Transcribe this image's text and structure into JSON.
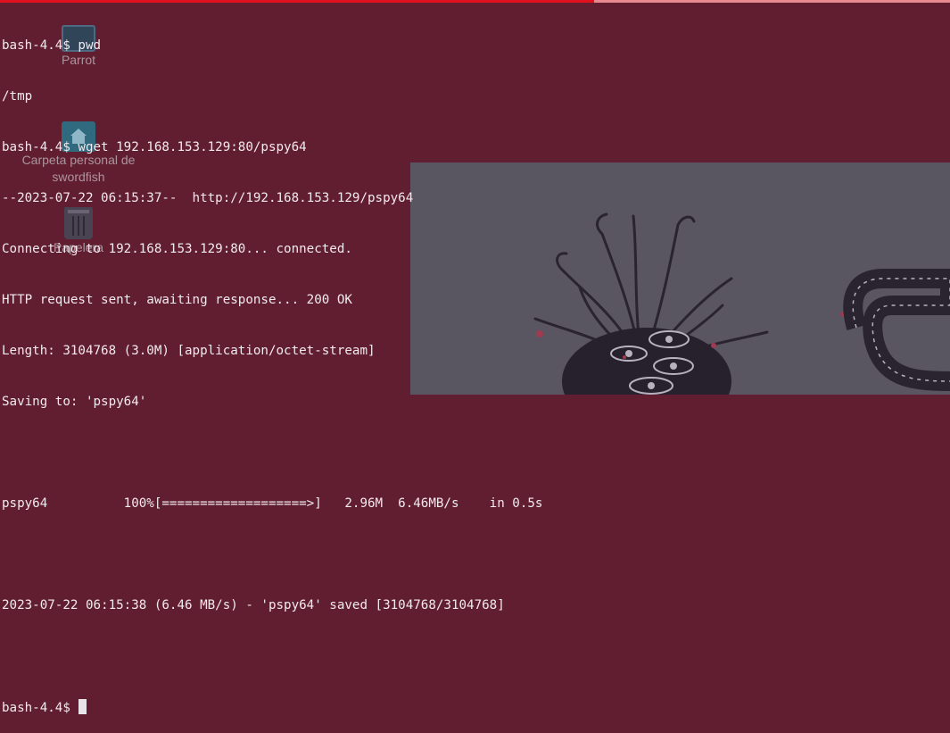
{
  "terminal": {
    "lines": [
      "bash-4.4$ pwd",
      "/tmp",
      "bash-4.4$ wget 192.168.153.129:80/pspy64",
      "--2023-07-22 06:15:37--  http://192.168.153.129/pspy64",
      "Connecting to 192.168.153.129:80... connected.",
      "HTTP request sent, awaiting response... 200 OK",
      "Length: 3104768 (3.0M) [application/octet-stream]",
      "Saving to: 'pspy64'",
      "",
      "pspy64          100%[===================>]   2.96M  6.46MB/s    in 0.5s",
      "",
      "2023-07-22 06:15:38 (6.46 MB/s) - 'pspy64' saved [3104768/3104768]",
      "",
      "bash-4.4$ "
    ]
  },
  "desktop": {
    "icons": [
      {
        "label": "Parrot",
        "icon": "monitor-icon"
      },
      {
        "label": "Carpeta personal de swordfish",
        "icon": "home-folder-icon"
      },
      {
        "label": "Papelera",
        "icon": "trash-icon"
      }
    ]
  },
  "colors": {
    "background": "#621e31",
    "text": "#f1eaee",
    "accent_bar": "#e0101e"
  }
}
